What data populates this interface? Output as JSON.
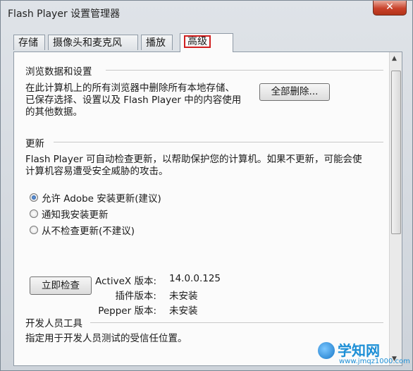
{
  "window": {
    "title": "Flash Player 设置管理器",
    "close_label": "✕"
  },
  "tabs": [
    {
      "label": "存储"
    },
    {
      "label": "摄像头和麦克风"
    },
    {
      "label": "播放"
    },
    {
      "label": "高级",
      "active": true
    }
  ],
  "browsing": {
    "title": "浏览数据和设置",
    "description_lines": [
      "在此计算机上的所有浏览器中删除所有本地存储、",
      "已保存选择、设置以及 Flash Player 中的内容使用",
      "的其他数据。"
    ],
    "delete_all_button": "全部删除..."
  },
  "updates": {
    "title": "更新",
    "description_lines": [
      "Flash Player 可自动检查更新，以帮助保护您的计算机。如果不更新，可能会使",
      "计算机容易遭受安全威胁的攻击。"
    ],
    "options": [
      {
        "label": "允许 Adobe 安装更新(建议)",
        "checked": true
      },
      {
        "label": "通知我安装更新",
        "checked": false
      },
      {
        "label": "从不检查更新(不建议)",
        "checked": false
      }
    ],
    "check_now_button": "立即检查",
    "versions": [
      {
        "label": "ActiveX 版本:",
        "value": "14.0.0.125"
      },
      {
        "label": "插件版本:",
        "value": "未安装"
      },
      {
        "label": "Pepper 版本:",
        "value": "未安装"
      }
    ]
  },
  "developer": {
    "title": "开发人员工具",
    "description": "指定用于开发人员测试的受信任位置。"
  },
  "watermark": {
    "text": "学知网",
    "url": "www.jmqz1000.com"
  },
  "colors": {
    "accent_red": "#d02020",
    "radio_selected": "#1d4f9a"
  },
  "icons": {
    "close": "close-icon",
    "scroll_up": "scroll-up-icon",
    "scroll_down": "scroll-down-icon"
  }
}
